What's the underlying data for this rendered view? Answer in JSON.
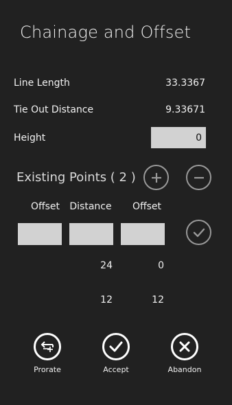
{
  "page": {
    "title": "Chainage and Offset"
  },
  "fields": {
    "line_length": {
      "label": "Line Length",
      "value": "33.3367"
    },
    "tie_out_distance": {
      "label": "Tie Out Distance",
      "value": "9.33671"
    },
    "height": {
      "label": "Height",
      "value": "0"
    }
  },
  "existing_points": {
    "title": "Existing Points ( 2 )",
    "columns": [
      "Offset",
      "Distance",
      "Offset"
    ],
    "rows": [
      {
        "distance": "24",
        "offset": "0"
      },
      {
        "distance": "12",
        "offset": "12"
      }
    ]
  },
  "app_bar": {
    "prorate_label": "Prorate",
    "accept_label": "Accept",
    "abandon_label": "Abandon"
  },
  "icons": {
    "add": "plus-circle-icon",
    "remove": "minus-circle-icon",
    "confirm": "check-circle-icon",
    "prorate": "prorate-icon",
    "accept": "check-icon",
    "abandon": "x-icon"
  },
  "colors": {
    "background": "#212121",
    "input": "#d2d2d2",
    "muted_circle": "#9a9a9a"
  }
}
